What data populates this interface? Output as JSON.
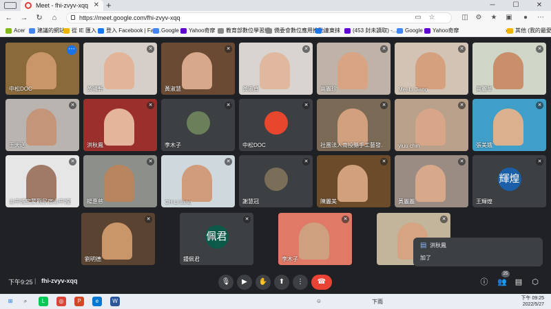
{
  "browser": {
    "tab_title": "Meet - fhi-zvyv-xqq",
    "url": "https://meet.google.com/fhi-zvyv-xqq",
    "bookmarks": [
      {
        "label": "Acer",
        "color": "#83b81a"
      },
      {
        "label": "建議的網站",
        "color": "#4285f4"
      },
      {
        "label": "從 IE 匯入",
        "color": "#f0b400"
      },
      {
        "label": "登入 Facebook | Fac...",
        "color": "#1877f2"
      },
      {
        "label": "Google",
        "color": "#4285f4"
      },
      {
        "label": "Yahoo奇摩",
        "color": "#6001d2"
      },
      {
        "label": "教育部數位學習網",
        "color": "#888888"
      },
      {
        "label": "僑委會數位應用推動...",
        "color": "#888888"
      },
      {
        "label": "連東抹",
        "color": "#1877f2"
      },
      {
        "label": "(453 封未讀取) -...",
        "color": "#6001d2"
      },
      {
        "label": "Google",
        "color": "#4285f4"
      },
      {
        "label": "Yahoo奇摩",
        "color": "#6001d2"
      }
    ],
    "other_bookmarks": "其他 (我的最愛)"
  },
  "participants": [
    {
      "name": "中松DOC",
      "type": "video",
      "bg": "#8a6a3a",
      "skin": "#c9966a",
      "menu": true
    },
    {
      "name": "黃晴軒",
      "type": "video",
      "bg": "#d6cfc9",
      "skin": "#e2b49a"
    },
    {
      "name": "黃淑慧",
      "type": "video",
      "bg": "#6b4a33",
      "skin": "#d7a98a"
    },
    {
      "name": "黃淑貞",
      "type": "video",
      "bg": "#d9d4cf",
      "skin": "#e0b89f"
    },
    {
      "name": "高麗珍",
      "type": "video",
      "bg": "#bfb3a7",
      "skin": "#d9a484"
    },
    {
      "name": "Mei-Li Jiang",
      "type": "video",
      "bg": "#d2c3b4",
      "skin": "#d4a07e"
    },
    {
      "name": "高麗華",
      "type": "video",
      "bg": "#cfd6c7",
      "skin": "#c98e6a"
    },
    {
      "name": "王天送",
      "type": "video",
      "bg": "#b9b4b0",
      "skin": "#c5957a"
    },
    {
      "name": "洪秋鳳",
      "type": "video",
      "bg": "#9b2f2b",
      "skin": "#e4b59b"
    },
    {
      "name": "李木子",
      "type": "avatar",
      "avatar_text": "",
      "avatar_color": "#6a7f5a"
    },
    {
      "name": "中松DOC",
      "type": "avatar",
      "avatar_text": "",
      "avatar_color": "#e8472d"
    },
    {
      "name": "社團法人南投縣手工藝發...",
      "type": "video",
      "bg": "#7b6a56",
      "skin": "#d1a07e"
    },
    {
      "name": "yiuu chin",
      "type": "video",
      "bg": "#b8a08a",
      "skin": "#d7a588"
    },
    {
      "name": "張美娥",
      "type": "video",
      "bg": "#3f9fc8",
      "skin": "#dab08f"
    },
    {
      "name": "山中城宝蒙觀民宿山中城宝",
      "type": "video",
      "bg": "#e6e6e6",
      "skin": "#a07a66"
    },
    {
      "name": "楊惠慈",
      "type": "video",
      "bg": "#8c8f8a",
      "skin": "#b9855e"
    },
    {
      "name": "CH Li liang",
      "type": "video",
      "bg": "#cfd8dc",
      "skin": "#d09c7c"
    },
    {
      "name": "謝慧冠",
      "type": "avatar",
      "avatar_text": "",
      "avatar_color": "#7b6e59"
    },
    {
      "name": "陳麗美",
      "type": "video",
      "bg": "#6b4b2a",
      "skin": "#d1a07c"
    },
    {
      "name": "黃麗麗",
      "type": "video",
      "bg": "#9a8c83",
      "skin": "#d7a98a"
    },
    {
      "name": "王輝煌",
      "type": "avatar",
      "avatar_text": "輝煌",
      "avatar_color": "#1a5fa8"
    },
    {
      "name": "劉明德",
      "type": "video",
      "bg": "#5a4431",
      "skin": "#c9966a"
    },
    {
      "name": "鍾佩君",
      "type": "avatar",
      "avatar_text": "佩君",
      "avatar_color": "#0b5a4a"
    },
    {
      "name": "李木子",
      "type": "video",
      "bg": "#e07a66",
      "skin": "#cfa080"
    },
    {
      "name": "",
      "type": "video",
      "bg": "#c2b59b",
      "skin": "#d6a383"
    }
  ],
  "chat_popup": {
    "sender": "洪秋鳳",
    "message": "加了"
  },
  "controls": {
    "time": "下午9:25",
    "separator": "|",
    "meeting_code": "fhi-zvyv-xqq",
    "participant_count": "25"
  },
  "taskbar": {
    "weather": "下雨",
    "time": "下午 09:25",
    "date": "2022/5/27"
  }
}
